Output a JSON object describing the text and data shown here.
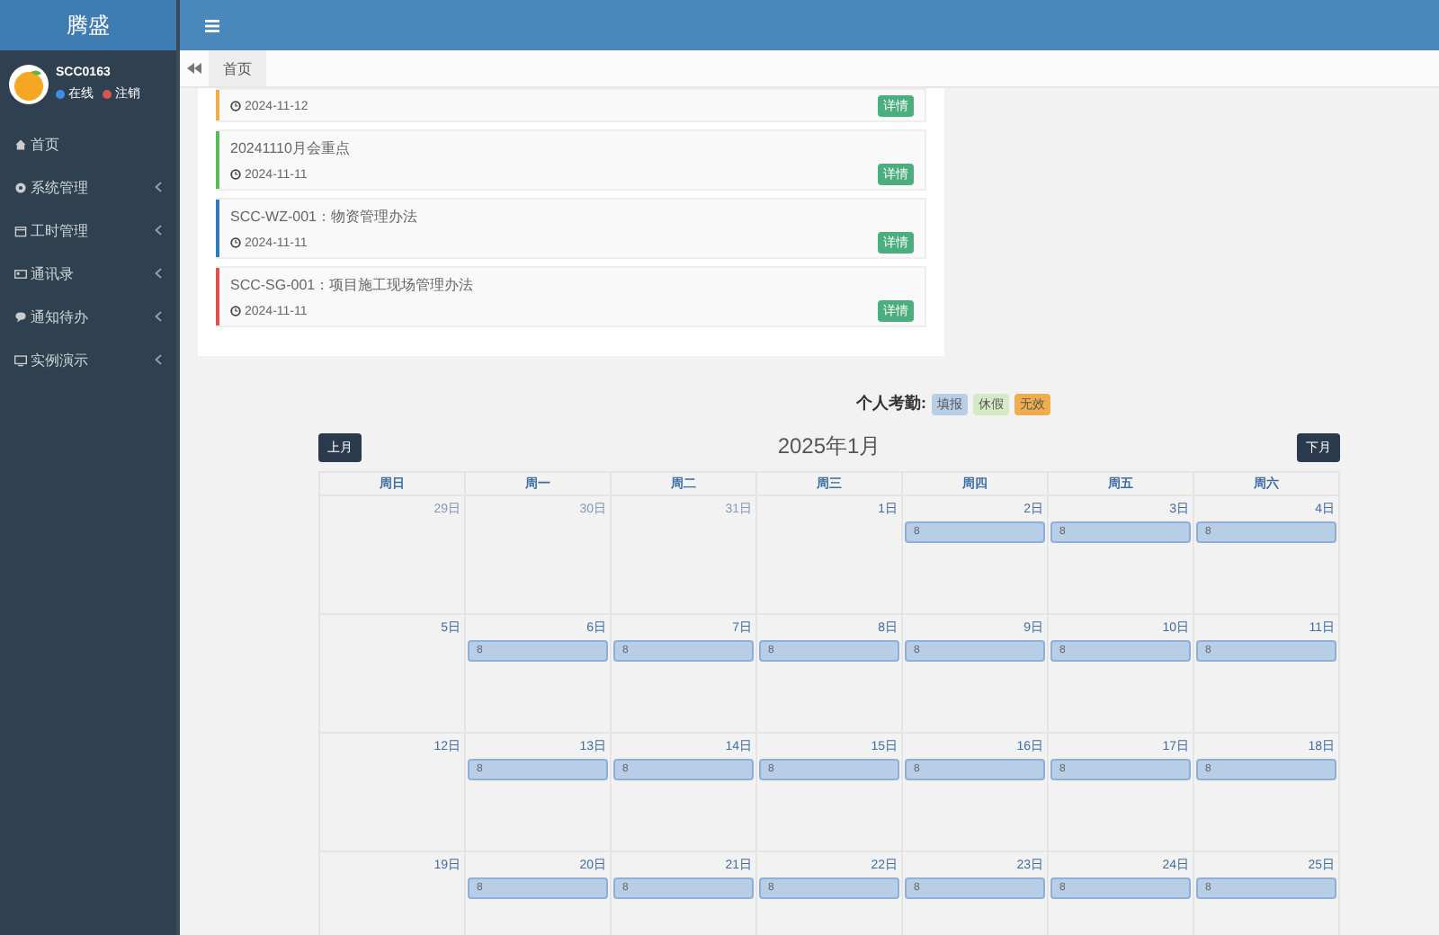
{
  "brand": "腾盛",
  "user": {
    "name": "SCC0163",
    "status": "在线",
    "logout": "注销"
  },
  "sidebar": {
    "items": [
      {
        "label": "首页",
        "expandable": false
      },
      {
        "label": "系统管理",
        "expandable": true
      },
      {
        "label": "工时管理",
        "expandable": true
      },
      {
        "label": "通讯录",
        "expandable": true
      },
      {
        "label": "通知待办",
        "expandable": true
      },
      {
        "label": "实例演示",
        "expandable": true
      }
    ]
  },
  "tabs": [
    {
      "label": "首页",
      "selected": true
    }
  ],
  "notices": [
    {
      "date": "2024-11-12",
      "color": "#f0ad4e",
      "action": "详情"
    },
    {
      "title": "20241110月会重点",
      "date": "2024-11-11",
      "color": "#5cb85c",
      "action": "详情"
    },
    {
      "title": "SCC-WZ-001：物资管理办法",
      "date": "2024-11-11",
      "color": "#337ab7",
      "action": "详情"
    },
    {
      "title": "SCC-SG-001：项目施工现场管理办法",
      "date": "2024-11-11",
      "color": "#d9534f",
      "action": "详情"
    }
  ],
  "attendance": {
    "label": "个人考勤:",
    "legend": [
      {
        "label": "填报",
        "color": "#b8cde6"
      },
      {
        "label": "休假",
        "color": "#d6e9c6"
      },
      {
        "label": "无效",
        "color": "#f0ad4e"
      }
    ]
  },
  "calendar": {
    "title": "2025年1月",
    "prev": "上月",
    "next": "下月",
    "weekdays": [
      "周日",
      "周一",
      "周二",
      "周三",
      "周四",
      "周五",
      "周六"
    ],
    "weeks": [
      [
        {
          "day": "29日",
          "muted": true
        },
        {
          "day": "30日",
          "muted": true
        },
        {
          "day": "31日",
          "muted": true
        },
        {
          "day": "1日",
          "muted": false
        },
        {
          "day": "2日",
          "muted": false,
          "event": "8"
        },
        {
          "day": "3日",
          "muted": false,
          "event": "8"
        },
        {
          "day": "4日",
          "muted": false,
          "event": "8"
        }
      ],
      [
        {
          "day": "5日",
          "muted": false
        },
        {
          "day": "6日",
          "muted": false,
          "event": "8"
        },
        {
          "day": "7日",
          "muted": false,
          "event": "8"
        },
        {
          "day": "8日",
          "muted": false,
          "event": "8"
        },
        {
          "day": "9日",
          "muted": false,
          "event": "8"
        },
        {
          "day": "10日",
          "muted": false,
          "event": "8"
        },
        {
          "day": "11日",
          "muted": false,
          "event": "8"
        }
      ],
      [
        {
          "day": "12日",
          "muted": false
        },
        {
          "day": "13日",
          "muted": false,
          "event": "8"
        },
        {
          "day": "14日",
          "muted": false,
          "event": "8"
        },
        {
          "day": "15日",
          "muted": false,
          "event": "8"
        },
        {
          "day": "16日",
          "muted": false,
          "event": "8"
        },
        {
          "day": "17日",
          "muted": false,
          "event": "8"
        },
        {
          "day": "18日",
          "muted": false,
          "event": "8"
        }
      ],
      [
        {
          "day": "19日",
          "muted": false
        },
        {
          "day": "20日",
          "muted": false,
          "event": "8"
        },
        {
          "day": "21日",
          "muted": false,
          "event": "8"
        },
        {
          "day": "22日",
          "muted": false,
          "event": "8"
        },
        {
          "day": "23日",
          "muted": false,
          "event": "8"
        },
        {
          "day": "24日",
          "muted": false,
          "event": "8"
        },
        {
          "day": "25日",
          "muted": false,
          "event": "8"
        }
      ]
    ]
  }
}
